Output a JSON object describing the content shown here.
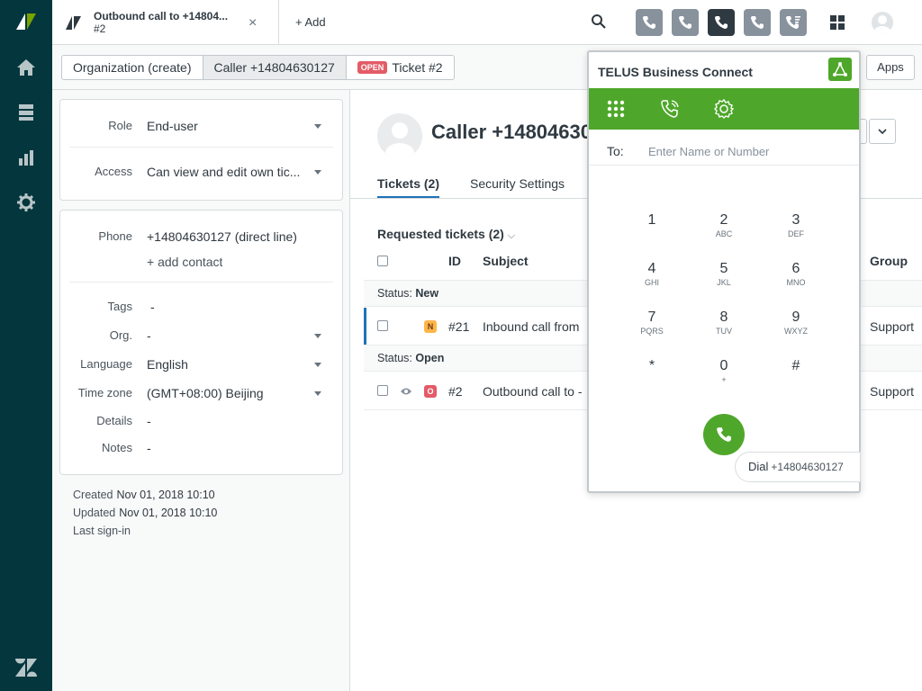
{
  "tab": {
    "title": "Outbound call to +14804...",
    "sub": "#2",
    "close": "×"
  },
  "topbar": {
    "add_label": "+ Add"
  },
  "breadcrumb": {
    "items": [
      "Organization (create)",
      "Caller +14804630127"
    ],
    "ticket_badge": "OPEN",
    "ticket_label": "Ticket #2"
  },
  "apps_label": "Apps",
  "user_fields": {
    "role_label": "Role",
    "role_value": "End-user",
    "access_label": "Access",
    "access_value": "Can view and edit own tic...",
    "phone_label": "Phone",
    "phone_value": "+14804630127 (direct line)",
    "add_contact": "+ add contact",
    "tags_label": "Tags",
    "tags_value": "-",
    "org_label": "Org.",
    "org_value": "-",
    "language_label": "Language",
    "language_value": "English",
    "timezone_label": "Time zone",
    "timezone_value": "(GMT+08:00) Beijing",
    "details_label": "Details",
    "details_value": "-",
    "notes_label": "Notes",
    "notes_value": "-"
  },
  "meta": {
    "created_label": "Created",
    "created_value": "Nov 01, 2018 10:10",
    "updated_label": "Updated",
    "updated_value": "Nov 01, 2018 10:10",
    "signin_label": "Last sign-in"
  },
  "user": {
    "name": "Caller +14804630"
  },
  "user_tabs": [
    "Tickets (2)",
    "Security Settings"
  ],
  "tickets": {
    "title": "Requested tickets (2)",
    "columns": {
      "id": "ID",
      "subject": "Subject",
      "group": "Group"
    },
    "status_label": "Status:",
    "groups": [
      {
        "status": "New",
        "badge": "N",
        "id": "#21",
        "subject": "Inbound call from",
        "group": "Support"
      },
      {
        "status": "Open",
        "badge": "O",
        "id": "#2",
        "subject": "Outbound call to -",
        "group": "Support"
      }
    ]
  },
  "dialer": {
    "title": "TELUS Business Connect",
    "to_label": "To:",
    "to_placeholder": "Enter Name or Number",
    "keys": [
      {
        "d": "1",
        "l": ""
      },
      {
        "d": "2",
        "l": "ABC"
      },
      {
        "d": "3",
        "l": "DEF"
      },
      {
        "d": "4",
        "l": "GHI"
      },
      {
        "d": "5",
        "l": "JKL"
      },
      {
        "d": "6",
        "l": "MNO"
      },
      {
        "d": "7",
        "l": "PQRS"
      },
      {
        "d": "8",
        "l": "TUV"
      },
      {
        "d": "9",
        "l": "WXYZ"
      },
      {
        "d": "*",
        "l": ""
      },
      {
        "d": "0",
        "l": "+"
      },
      {
        "d": "#",
        "l": ""
      }
    ],
    "dial_label": "Dial",
    "dial_number": "+14804630127"
  },
  "colors": {
    "nav_bg": "#03363d",
    "accent_green": "#4ea72a",
    "open_red": "#e35b66",
    "new_yellow": "#ffb648",
    "link_blue": "#1f73b7"
  }
}
